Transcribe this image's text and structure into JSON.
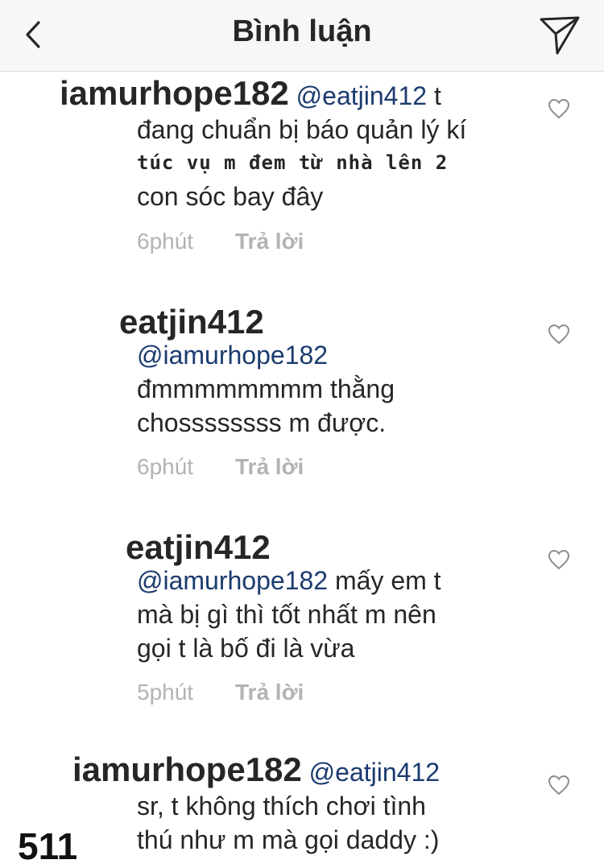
{
  "header": {
    "title": "Bình luận",
    "back_icon": "chevron-left-icon",
    "send_icon": "paper-plane-icon"
  },
  "comments": [
    {
      "username": "iamurhope182",
      "mention": "@eatjin412",
      "text_parts": [
        "t",
        "đang chuẩn bị báo quản lý kí",
        "túc vụ m đem từ nhà lên 2",
        "con sóc bay đây"
      ],
      "time": "6phút",
      "reply_label": "Trả lời"
    },
    {
      "username": "eatjin412",
      "mention": "@iamurhope182",
      "text_parts": [
        "đmmmmmmmm thằng",
        "chossssssss m được."
      ],
      "time": "6phút",
      "reply_label": "Trả lời"
    },
    {
      "username": "eatjin412",
      "mention": "@iamurhope182",
      "text_parts": [
        "mấy em t",
        "mà bị gì thì tốt nhất m nên",
        "gọi t là bố đi là vừa"
      ],
      "time": "5phút",
      "reply_label": "Trả lời"
    },
    {
      "username": "iamurhope182",
      "mention": "@eatjin412",
      "text_parts": [
        "sr, t không thích chơi tình",
        "thú như m mà gọi daddy :)"
      ]
    }
  ],
  "overlay": {
    "counter": "511"
  },
  "colors": {
    "mention": "#1b3b6f",
    "meta": "#b3b3b3",
    "header_bg": "#f7f7f7"
  }
}
